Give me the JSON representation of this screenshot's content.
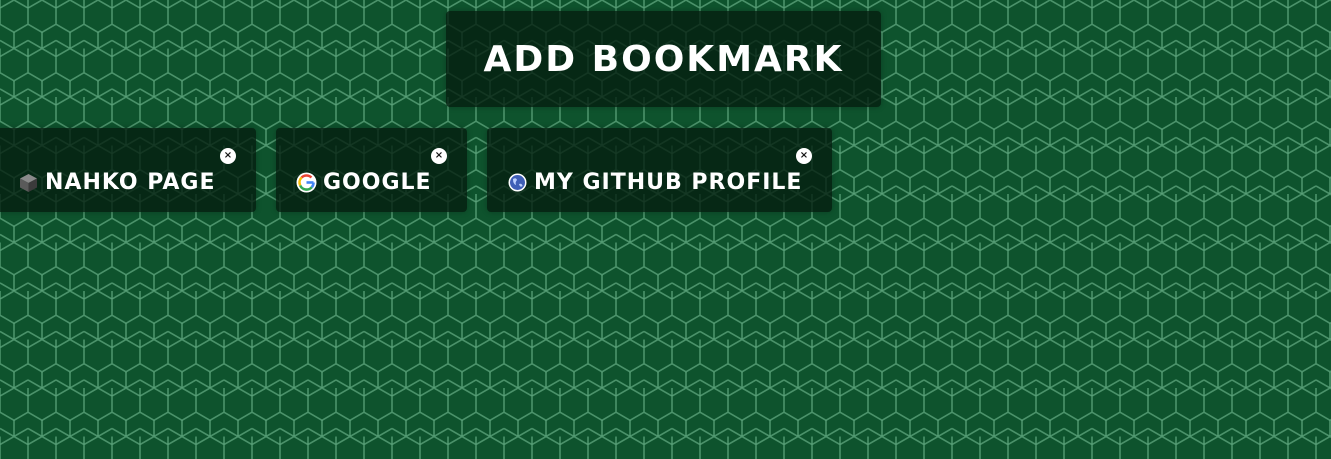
{
  "add_bookmark": {
    "label": "ADD BOOKMARK"
  },
  "bookmarks": [
    {
      "title": "NAHKO PAGE",
      "icon": "cube-icon",
      "close_label": "×"
    },
    {
      "title": "GOOGLE",
      "icon": "google-icon",
      "close_label": "×"
    },
    {
      "title": "MY GITHUB PROFILE",
      "icon": "globe-icon",
      "close_label": "×"
    }
  ],
  "colors": {
    "background": "#0e532d",
    "hex_lines": "#5fa77f",
    "panel": "#041c0e",
    "text": "#ffffff"
  }
}
